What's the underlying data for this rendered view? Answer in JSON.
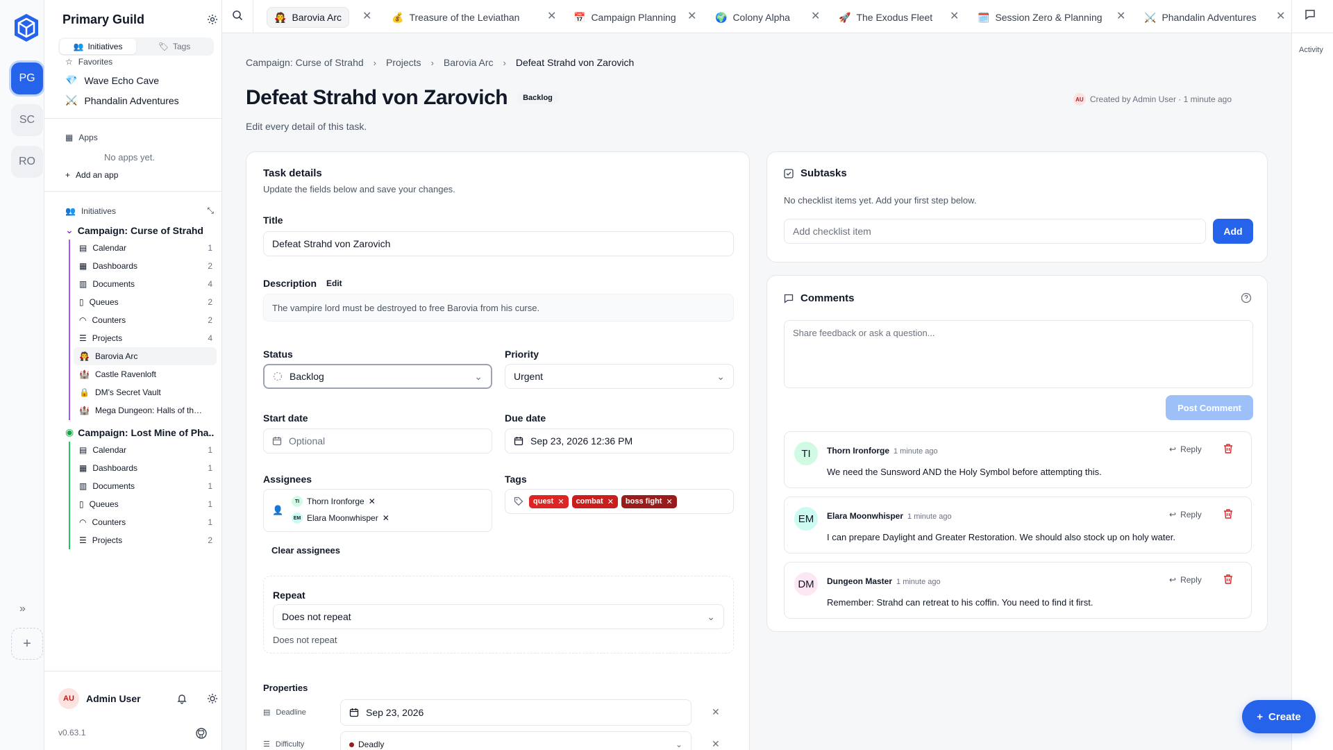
{
  "orgs": [
    "PG",
    "SC",
    "RO"
  ],
  "sidebar": {
    "title": "Primary Guild",
    "segments": [
      "Initiatives",
      "Tags"
    ],
    "favorites_label": "Favorites",
    "favorites": [
      {
        "icon": "💎",
        "label": "Wave Echo Cave"
      },
      {
        "icon": "⚔️",
        "label": "Phandalin Adventures"
      }
    ],
    "apps_label": "Apps",
    "no_apps": "No apps yet.",
    "add_app": "Add an app",
    "initiatives_label": "Initiatives",
    "campaigns": [
      {
        "name": "Campaign: Curse of Strahd",
        "items": [
          {
            "label": "Calendar",
            "count": "1"
          },
          {
            "label": "Dashboards",
            "count": "2"
          },
          {
            "label": "Documents",
            "count": "4"
          },
          {
            "label": "Queues",
            "count": "2"
          },
          {
            "label": "Counters",
            "count": "2"
          },
          {
            "label": "Projects",
            "count": "4"
          }
        ],
        "projects": [
          {
            "icon": "🧛",
            "label": "Barovia Arc"
          },
          {
            "icon": "🏰",
            "label": "Castle Ravenloft"
          },
          {
            "icon": "🔒",
            "label": "DM's Secret Vault"
          },
          {
            "icon": "🏰",
            "label": "Mega Dungeon: Halls of the ..."
          }
        ]
      },
      {
        "name": "Campaign: Lost Mine of Pha...",
        "items": [
          {
            "label": "Calendar",
            "count": "1"
          },
          {
            "label": "Dashboards",
            "count": "1"
          },
          {
            "label": "Documents",
            "count": "1"
          },
          {
            "label": "Queues",
            "count": "1"
          },
          {
            "label": "Counters",
            "count": "1"
          },
          {
            "label": "Projects",
            "count": "2"
          }
        ]
      }
    ],
    "user": {
      "initials": "AU",
      "name": "Admin User"
    },
    "version": "v0.63.1"
  },
  "tabs": [
    {
      "icon": "🧛",
      "label": "Barovia Arc"
    },
    {
      "icon": "💰",
      "label": "Treasure of the Leviathan"
    },
    {
      "icon": "📅",
      "label": "Campaign Planning"
    },
    {
      "icon": "🌍",
      "label": "Colony Alpha"
    },
    {
      "icon": "🚀",
      "label": "The Exodus Fleet"
    },
    {
      "icon": "🗓️",
      "label": "Session Zero & Planning"
    },
    {
      "icon": "⚔️",
      "label": "Phandalin Adventures"
    }
  ],
  "activity_label": "Activity",
  "breadcrumbs": [
    "Campaign: Curse of Strahd",
    "Projects",
    "Barovia Arc",
    "Defeat Strahd von Zarovich"
  ],
  "task": {
    "title": "Defeat Strahd von Zarovich",
    "status_badge": "Backlog",
    "created_initials": "AU",
    "created": "Created by Admin User · 1 minute ago",
    "subtitle": "Edit every detail of this task."
  },
  "details": {
    "heading": "Task details",
    "subheading": "Update the fields below and save your changes.",
    "title_label": "Title",
    "title_value": "Defeat Strahd von Zarovich",
    "description_label": "Description",
    "edit_label": "Edit",
    "description": "The vampire lord must be destroyed to free Barovia from his curse.",
    "status_label": "Status",
    "status_value": "Backlog",
    "priority_label": "Priority",
    "priority_value": "Urgent",
    "start_label": "Start date",
    "start_placeholder": "Optional",
    "due_label": "Due date",
    "due_value": "Sep 23, 2026 12:36 PM",
    "assignees_label": "Assignees",
    "assignees": [
      {
        "initials": "TI",
        "name": "Thorn Ironforge"
      },
      {
        "initials": "EM",
        "name": "Elara Moonwhisper"
      }
    ],
    "clear_assignees": "Clear assignees",
    "tags_label": "Tags",
    "tags": [
      {
        "name": "quest",
        "color": "#dc2626"
      },
      {
        "name": "combat",
        "color": "#c81e1e"
      },
      {
        "name": "boss fight",
        "color": "#991b1b"
      }
    ],
    "repeat_label": "Repeat",
    "repeat_value": "Does not repeat",
    "repeat_summary": "Does not repeat",
    "properties_label": "Properties",
    "properties": [
      {
        "label": "Deadline",
        "value": "Sep 23, 2026"
      },
      {
        "label": "Difficulty",
        "value": "Deadly"
      }
    ]
  },
  "subtasks": {
    "heading": "Subtasks",
    "empty": "No checklist items yet. Add your first step below.",
    "placeholder": "Add checklist item",
    "add": "Add"
  },
  "comments": {
    "heading": "Comments",
    "placeholder": "Share feedback or ask a question...",
    "post": "Post Comment",
    "reply": "Reply",
    "items": [
      {
        "initials": "TI",
        "author": "Thorn Ironforge",
        "when": "1 minute ago",
        "body": "We need the Sunsword AND the Holy Symbol before attempting this.",
        "color": "#d1fae5"
      },
      {
        "initials": "EM",
        "author": "Elara Moonwhisper",
        "when": "1 minute ago",
        "body": "I can prepare Daylight and Greater Restoration. We should also stock up on holy water.",
        "color": "#ccfbf1"
      },
      {
        "initials": "DM",
        "author": "Dungeon Master",
        "when": "1 minute ago",
        "body": "Remember: Strahd can retreat to his coffin. You need to find it first.",
        "color": "#fce7f3"
      }
    ]
  },
  "create_label": "Create"
}
